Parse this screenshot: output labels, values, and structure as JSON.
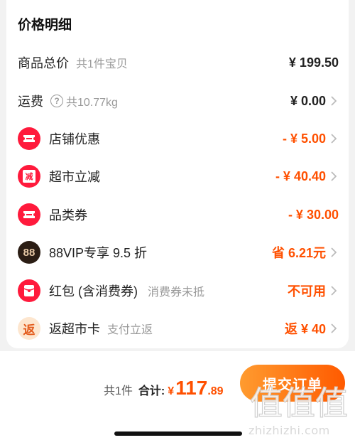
{
  "title": "价格明细",
  "rows": [
    {
      "label": "商品总价",
      "sub": "共1件宝贝",
      "value": "¥ 199.50",
      "value_color": "#222222",
      "has_chevron": false,
      "icon": "none"
    },
    {
      "label": "运费",
      "sub": "共10.77kg",
      "value": "¥ 0.00",
      "value_color": "#222222",
      "has_chevron": true,
      "icon": "question-icon"
    },
    {
      "label": "店铺优惠",
      "sub": "",
      "value": "- ¥ 5.00",
      "value_color": "#ff5000",
      "has_chevron": true,
      "icon": "ticket-icon"
    },
    {
      "label": "超市立减",
      "sub": "",
      "value": "- ¥ 40.40",
      "value_color": "#ff5000",
      "has_chevron": true,
      "icon": "reduce-icon"
    },
    {
      "label": "品类券",
      "sub": "",
      "value": "- ¥ 30.00",
      "value_color": "#ff5000",
      "has_chevron": false,
      "icon": "ticket-icon"
    },
    {
      "label": "88VIP专享 9.5 折",
      "sub": "",
      "value": "省 6.21元",
      "value_color": "#ff5000",
      "has_chevron": true,
      "icon": "vip88-icon"
    },
    {
      "label": "红包 (含消费券)",
      "sub": "消费券未抵",
      "value": "不可用",
      "value_color": "#ff5000",
      "has_chevron": true,
      "icon": "red-envelope-icon"
    },
    {
      "label": "返超市卡",
      "sub": "支付立返",
      "value": "返 ¥ 40",
      "value_color": "#ff5000",
      "has_chevron": true,
      "icon": "rebate-icon"
    }
  ],
  "icons": {
    "reduce_glyph": "减",
    "vip_glyph": "88",
    "rebate_glyph": "返"
  },
  "footer": {
    "count": "共1件",
    "total_label": "合计:",
    "currency": "¥",
    "total_int": "117",
    "total_dec": ".89",
    "submit_label": "提交订单"
  },
  "watermark": {
    "text": "zhizhizhi.com",
    "logo_glyphs": "值值值"
  },
  "colors": {
    "accent": "#ff5000",
    "icon_red": "#ff1a3c"
  }
}
